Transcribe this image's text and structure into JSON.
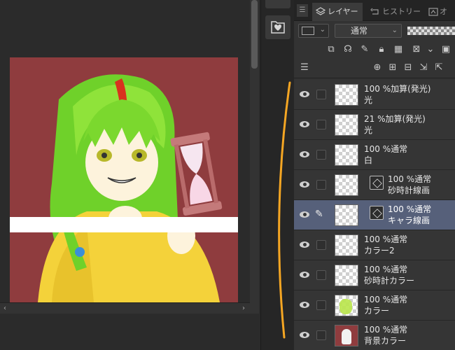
{
  "panel": {
    "tabs": {
      "menu_glyph": "☰",
      "layer": "レイヤー",
      "history": "ヒストリー",
      "other": "オ"
    },
    "blend_mode": "通常"
  },
  "layers": [
    {
      "line1": "100 %加算(発光)",
      "line2": "光",
      "thumb": "transparent",
      "selected": false
    },
    {
      "line1": "21 %加算(発光)",
      "line2": "光",
      "thumb": "transparent",
      "selected": false
    },
    {
      "line1": "100 %通常",
      "line2": "白",
      "thumb": "transparent",
      "selected": false
    },
    {
      "line1": "100 %通常",
      "line2": "砂時計線画",
      "thumb": "vector",
      "selected": false
    },
    {
      "line1": "100 %通常",
      "line2": "キャラ線画",
      "thumb": "vector",
      "selected": true
    },
    {
      "line1": "100 %通常",
      "line2": "カラー2",
      "thumb": "transparent",
      "selected": false
    },
    {
      "line1": "100 %通常",
      "line2": "砂時計カラー",
      "thumb": "transparent",
      "selected": false
    },
    {
      "line1": "100 %通常",
      "line2": "カラー",
      "thumb": "chara",
      "selected": false
    },
    {
      "line1": "100 %通常",
      "line2": "背景カラー",
      "thumb": "background",
      "selected": false
    }
  ],
  "colors": {
    "canvas_background": "#8f3c3e",
    "selected_row": "#56607a",
    "annotation": "#f5a623"
  },
  "icons": {
    "folder_button": "heart-folder-icon",
    "eye": "eye-icon",
    "pen": "pen-icon"
  }
}
